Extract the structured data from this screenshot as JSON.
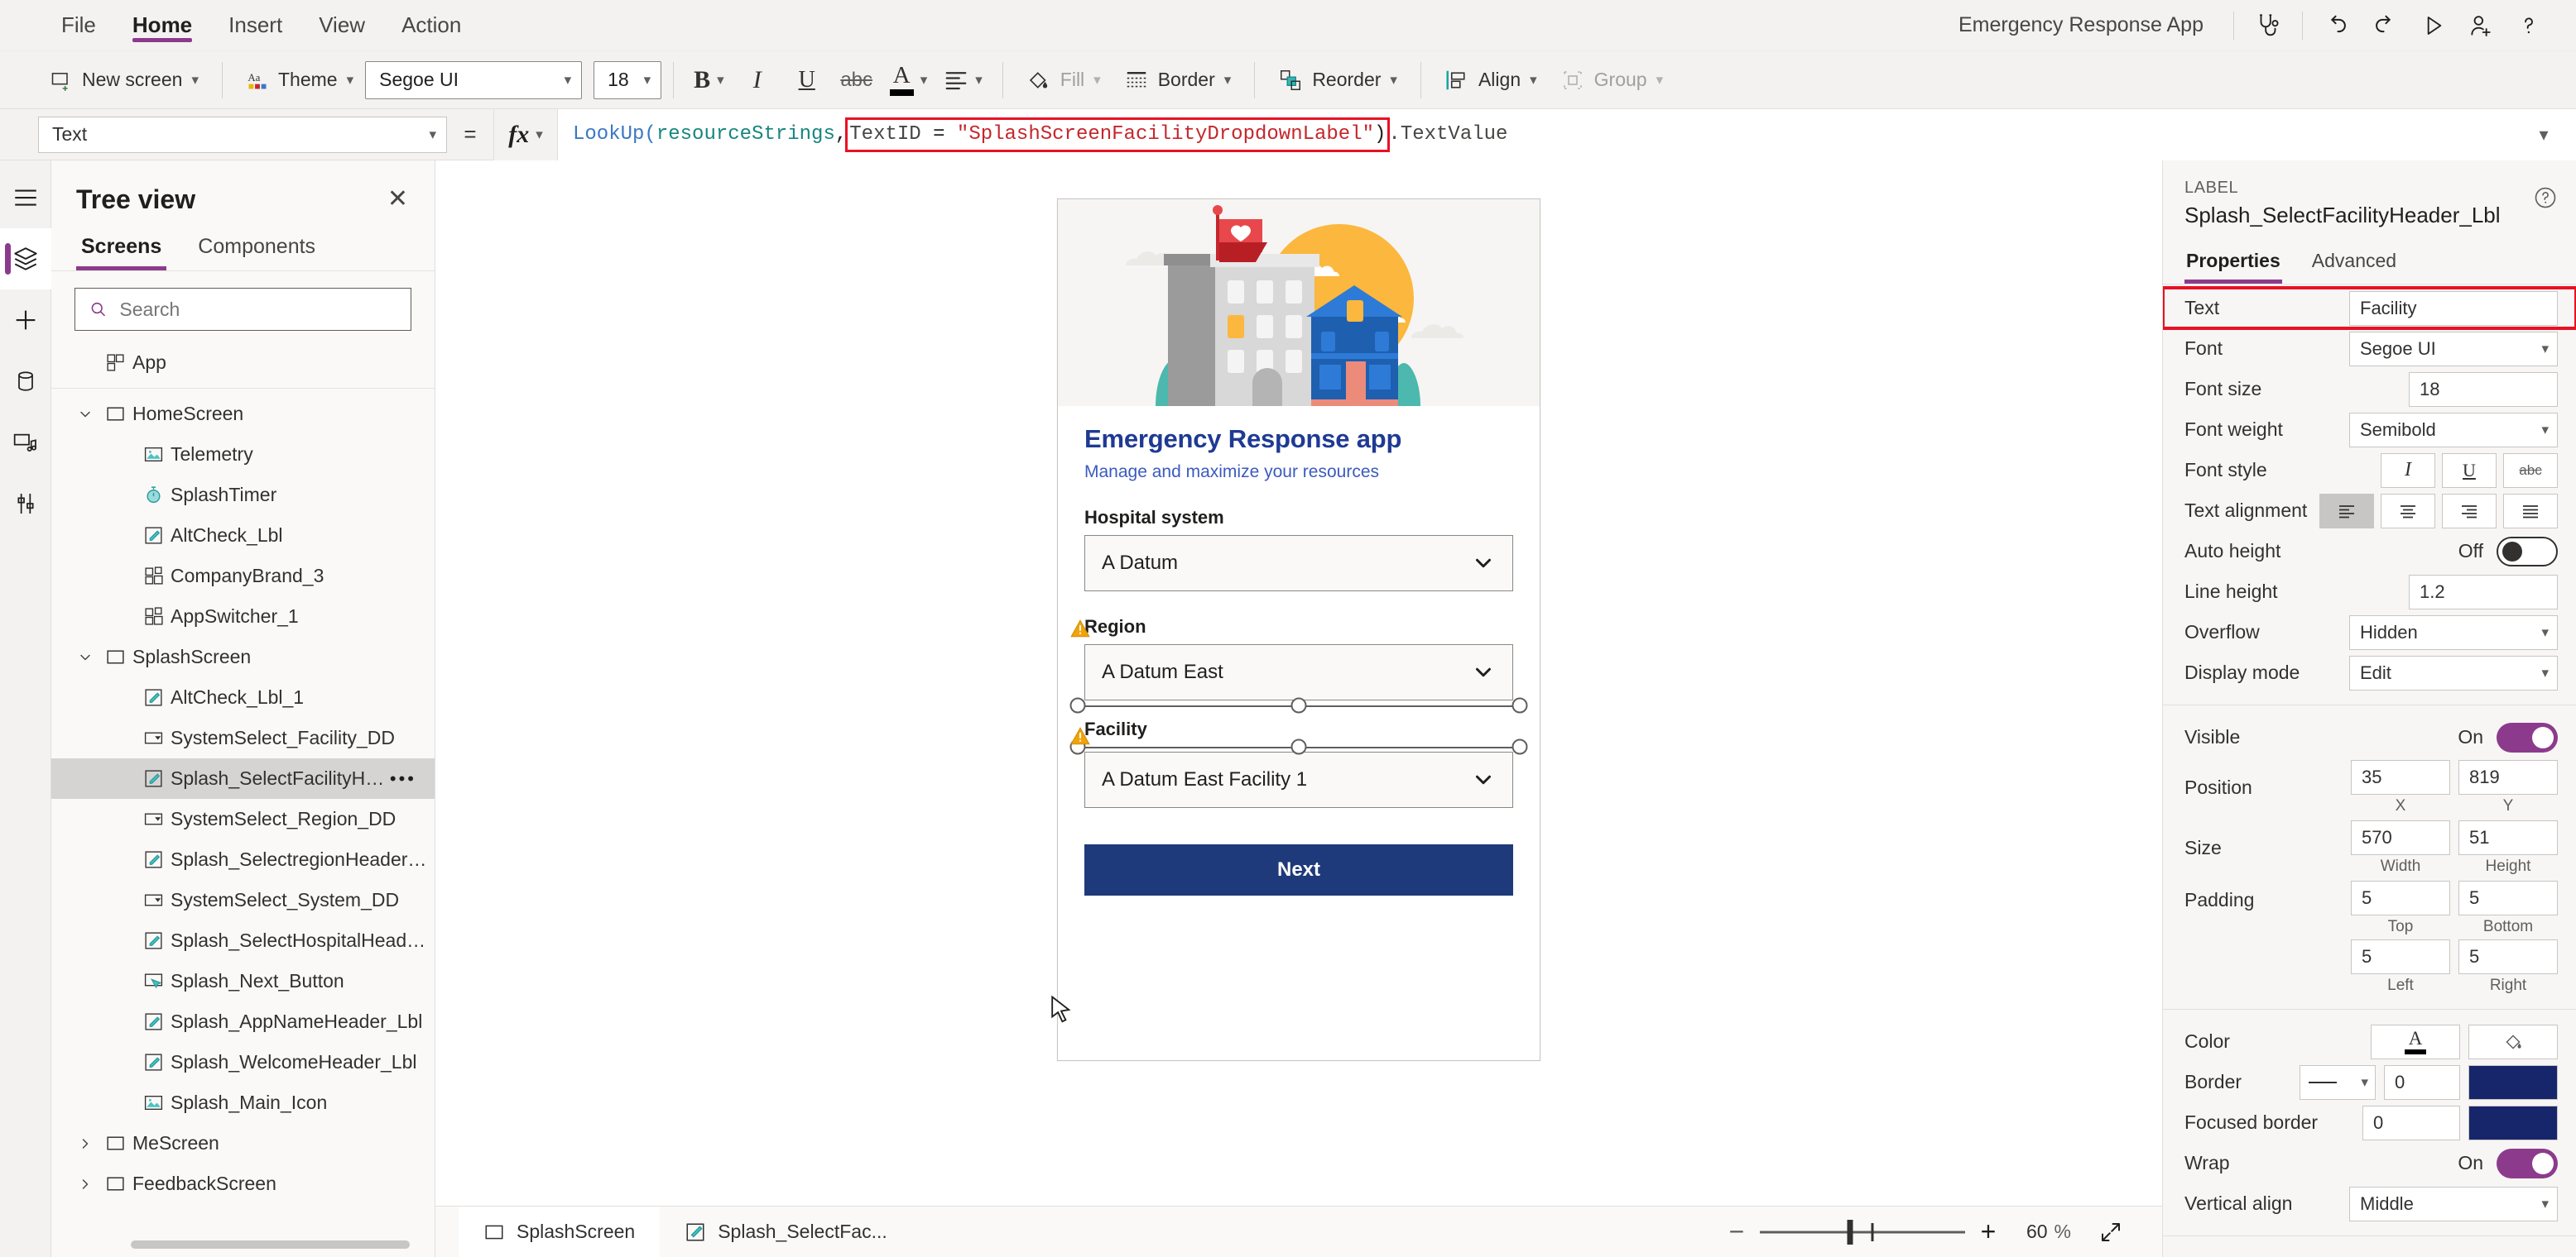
{
  "menubar": {
    "items": [
      {
        "label": "File",
        "active": false
      },
      {
        "label": "Home",
        "active": true
      },
      {
        "label": "Insert",
        "active": false
      },
      {
        "label": "View",
        "active": false
      },
      {
        "label": "Action",
        "active": false
      }
    ],
    "app_title": "Emergency Response App",
    "icons": [
      "app-checker-icon",
      "undo-icon",
      "redo-icon",
      "preview-icon",
      "share-icon",
      "help-icon"
    ]
  },
  "ribbon": {
    "new_screen": "New screen",
    "theme": "Theme",
    "font_family": "Segoe UI",
    "font_size": "18",
    "bold": "B",
    "italic": "I",
    "underline": "U",
    "strikethrough": "abc",
    "font_color": "A",
    "align": "align-icon",
    "fill": "Fill",
    "border": "Border",
    "reorder": "Reorder",
    "align_label": "Align",
    "group": "Group"
  },
  "formula_bar": {
    "property": "Text",
    "equals": "=",
    "fx": "fx",
    "formula": {
      "fn": "LookUp(",
      "table": "resourceStrings",
      "comma": ", ",
      "highlight_id": "TextID",
      "highlight_eq": " = ",
      "highlight_str": "\"SplashScreenFacilityDropdownLabel\"",
      "close": ")",
      "tail": ".TextValue"
    }
  },
  "rail": {
    "items": [
      "hamburger-menu-icon",
      "tree-view-icon",
      "insert-icon",
      "data-icon",
      "media-icon",
      "settings-icon"
    ]
  },
  "treeview": {
    "title": "Tree view",
    "close": "✕",
    "tabs": [
      {
        "label": "Screens",
        "active": true
      },
      {
        "label": "Components",
        "active": false
      }
    ],
    "search_placeholder": "Search",
    "search_value": "",
    "app_node": "App",
    "nodes": [
      {
        "label": "HomeScreen",
        "level": 1,
        "icon": "screen-icon",
        "twisty": "expanded",
        "selected": false
      },
      {
        "label": "Telemetry",
        "level": 2,
        "icon": "image-icon",
        "twisty": "none",
        "selected": false
      },
      {
        "label": "SplashTimer",
        "level": 2,
        "icon": "timer-icon",
        "twisty": "none",
        "selected": false
      },
      {
        "label": "AltCheck_Lbl",
        "level": 2,
        "icon": "label-icon",
        "twisty": "none",
        "selected": false
      },
      {
        "label": "CompanyBrand_3",
        "level": 2,
        "icon": "component-icon",
        "twisty": "none",
        "selected": false
      },
      {
        "label": "AppSwitcher_1",
        "level": 2,
        "icon": "component-icon",
        "twisty": "none",
        "selected": false
      },
      {
        "label": "SplashScreen",
        "level": 1,
        "icon": "screen-icon",
        "twisty": "expanded",
        "selected": false
      },
      {
        "label": "AltCheck_Lbl_1",
        "level": 2,
        "icon": "label-icon",
        "twisty": "none",
        "selected": false
      },
      {
        "label": "SystemSelect_Facility_DD",
        "level": 2,
        "icon": "dropdown-icon",
        "twisty": "none",
        "selected": false
      },
      {
        "label": "Splash_SelectFacilityHeader_Lbl",
        "level": 2,
        "icon": "label-icon",
        "twisty": "none",
        "selected": true,
        "menu": "•••"
      },
      {
        "label": "SystemSelect_Region_DD",
        "level": 2,
        "icon": "dropdown-icon",
        "twisty": "none",
        "selected": false
      },
      {
        "label": "Splash_SelectregionHeader_Lbl",
        "level": 2,
        "icon": "label-icon",
        "twisty": "none",
        "selected": false
      },
      {
        "label": "SystemSelect_System_DD",
        "level": 2,
        "icon": "dropdown-icon",
        "twisty": "none",
        "selected": false
      },
      {
        "label": "Splash_SelectHospitalHeader_Lbl",
        "level": 2,
        "icon": "label-icon",
        "twisty": "none",
        "selected": false
      },
      {
        "label": "Splash_Next_Button",
        "level": 2,
        "icon": "button-icon",
        "twisty": "none",
        "selected": false
      },
      {
        "label": "Splash_AppNameHeader_Lbl",
        "level": 2,
        "icon": "label-icon",
        "twisty": "none",
        "selected": false
      },
      {
        "label": "Splash_WelcomeHeader_Lbl",
        "level": 2,
        "icon": "label-icon",
        "twisty": "none",
        "selected": false
      },
      {
        "label": "Splash_Main_Icon",
        "level": 2,
        "icon": "image-icon",
        "twisty": "none",
        "selected": false
      },
      {
        "label": "MeScreen",
        "level": 1,
        "icon": "screen-icon",
        "twisty": "collapsed",
        "selected": false
      },
      {
        "label": "FeedbackScreen",
        "level": 1,
        "icon": "screen-icon",
        "twisty": "collapsed",
        "selected": false
      }
    ]
  },
  "canvas": {
    "app_name": "Emergency Response app",
    "tagline": "Manage and maximize your resources",
    "fields": [
      {
        "label": "Hospital system",
        "value": "A Datum",
        "warning": false
      },
      {
        "label": "Region",
        "value": "A Datum East",
        "warning": true
      },
      {
        "label": "Facility",
        "value": "A Datum East Facility 1",
        "warning": true,
        "selected": true
      }
    ],
    "next_button": "Next"
  },
  "bottombar": {
    "breadcrumb": [
      {
        "label": "SplashScreen",
        "icon": "screen-icon"
      },
      {
        "label": "Splash_SelectFac...",
        "icon": "label-icon"
      }
    ],
    "zoom_minus": "−",
    "zoom_plus": "+",
    "zoom_value": "60",
    "zoom_unit": "%",
    "fit_icon": "fit-screen-icon"
  },
  "properties": {
    "kind": "LABEL",
    "name": "Splash_SelectFacilityHeader_Lbl",
    "help": "?",
    "tabs": [
      {
        "label": "Properties",
        "active": true
      },
      {
        "label": "Advanced",
        "active": false
      }
    ],
    "rows": {
      "text_label": "Text",
      "text_value": "Facility",
      "font_label": "Font",
      "font_value": "Segoe UI",
      "font_size_label": "Font size",
      "font_size_value": "18",
      "font_weight_label": "Font weight",
      "font_weight_value": "Semibold",
      "font_style_label": "Font style",
      "font_style_italic": "I",
      "font_style_underline": "U",
      "font_style_strike": "abc",
      "text_align_label": "Text alignment",
      "auto_height_label": "Auto height",
      "auto_height_value": "Off",
      "line_height_label": "Line height",
      "line_height_value": "1.2",
      "overflow_label": "Overflow",
      "overflow_value": "Hidden",
      "display_mode_label": "Display mode",
      "display_mode_value": "Edit",
      "visible_label": "Visible",
      "visible_value": "On",
      "position_label": "Position",
      "position_x": "35",
      "position_y": "819",
      "position_x_sub": "X",
      "position_y_sub": "Y",
      "size_label": "Size",
      "size_w": "570",
      "size_h": "51",
      "size_w_sub": "Width",
      "size_h_sub": "Height",
      "padding_label": "Padding",
      "padding_top": "5",
      "padding_bottom": "5",
      "padding_left": "5",
      "padding_right": "5",
      "padding_top_sub": "Top",
      "padding_bottom_sub": "Bottom",
      "padding_left_sub": "Left",
      "padding_right_sub": "Right",
      "color_label": "Color",
      "border_label": "Border",
      "border_width": "0",
      "focused_border_label": "Focused border",
      "focused_border_width": "0",
      "wrap_label": "Wrap",
      "wrap_value": "On",
      "vertical_align_label": "Vertical align",
      "vertical_align_value": "Middle"
    }
  },
  "colors": {
    "accent": "#8c3b8c",
    "brand_blue": "#1f3a7a",
    "border_color": "#17256b",
    "warning": "#f0a30a",
    "selection_red": "#e81123"
  }
}
